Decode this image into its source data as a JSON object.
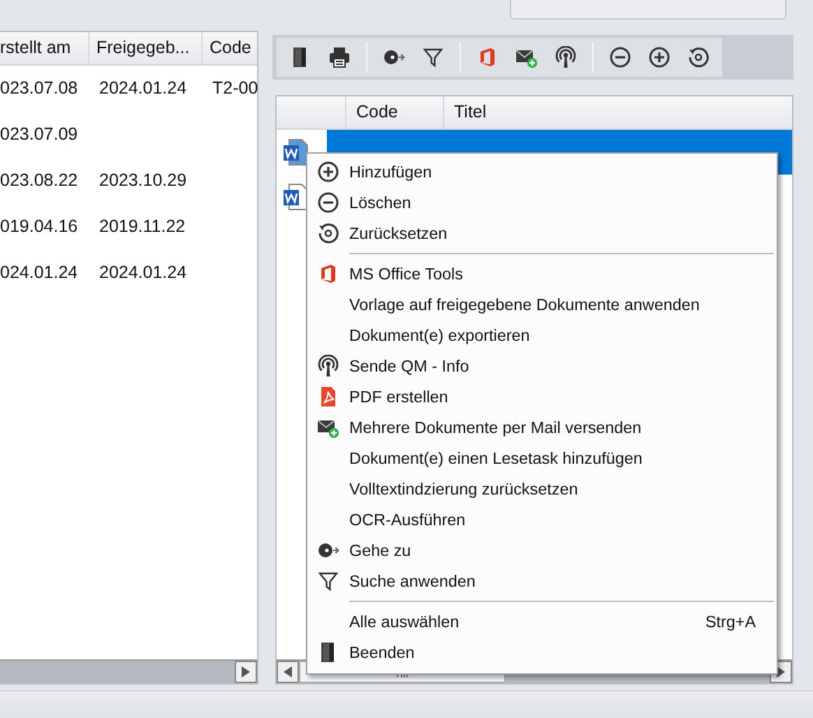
{
  "left_table": {
    "columns": [
      {
        "label": "rstellt am"
      },
      {
        "label": "Freigegeb..."
      },
      {
        "label": "Code"
      }
    ],
    "rows": [
      [
        "023.07.08",
        "2024.01.24",
        "T2-00"
      ],
      [
        "023.07.09",
        null,
        null
      ],
      [
        "023.08.22",
        "2023.10.29",
        null
      ],
      [
        "019.04.16",
        "2019.11.22",
        null
      ],
      [
        "024.01.24",
        "2024.01.24",
        null
      ]
    ]
  },
  "document_grid": {
    "columns": [
      {
        "label": "Code"
      },
      {
        "label": "Titel"
      }
    ],
    "rows": [
      {
        "selected": true
      },
      {
        "selected": false
      }
    ]
  },
  "context_menu": [
    {
      "kind": "item",
      "label": "Hinzufügen"
    },
    {
      "kind": "item",
      "label": "Löschen"
    },
    {
      "kind": "item",
      "label": "Zurücksetzen"
    },
    {
      "kind": "separator"
    },
    {
      "kind": "item",
      "label": "MS Office Tools"
    },
    {
      "kind": "item",
      "label": "Vorlage auf freigegebene Dokumente anwenden"
    },
    {
      "kind": "item",
      "label": "Dokument(e) exportieren"
    },
    {
      "kind": "item",
      "label": "Sende QM - Info"
    },
    {
      "kind": "item",
      "label": "PDF erstellen"
    },
    {
      "kind": "item",
      "label": "Mehrere Dokumente per Mail versenden"
    },
    {
      "kind": "item",
      "label": "Dokument(e) einen Lesetask hinzufügen"
    },
    {
      "kind": "item",
      "label": "Volltextindzierung zurücksetzen"
    },
    {
      "kind": "item",
      "label": "OCR-Ausführen"
    },
    {
      "kind": "item",
      "label": "Gehe zu"
    },
    {
      "kind": "item",
      "label": "Suche anwenden"
    },
    {
      "kind": "separator"
    },
    {
      "kind": "item",
      "label": "Alle auswählen",
      "shortcut": "Strg+A"
    },
    {
      "kind": "item",
      "label": "Beenden"
    }
  ]
}
